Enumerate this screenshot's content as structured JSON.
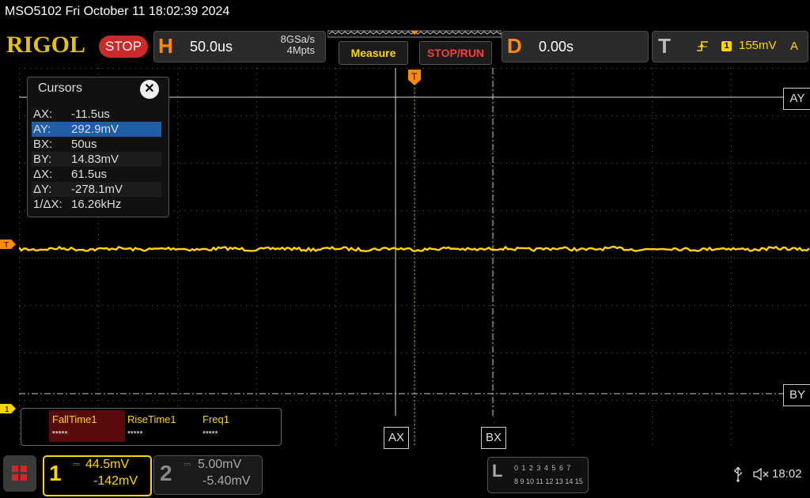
{
  "header": {
    "model_time": "MSO5102  Fri October 11 18:02:39 2024",
    "logo": "RIGOL",
    "run_state": "STOP"
  },
  "horizontal": {
    "letter": "H",
    "timebase": "50.0us",
    "sample_rate": "8GSa/s",
    "memory_depth": "4Mpts"
  },
  "buttons": {
    "measure": "Measure",
    "stop_run": "STOP/RUN"
  },
  "delay": {
    "letter": "D",
    "value": "0.00s"
  },
  "trigger": {
    "letter": "T",
    "channel": "1",
    "level": "155mV",
    "mode": "A",
    "level_marker": "T",
    "position_marker": "T"
  },
  "cursors": {
    "title": "Cursors",
    "close_glyph": "✕",
    "selected_index": 1,
    "rows": [
      {
        "key": "AX:",
        "value": "-11.5us"
      },
      {
        "key": "AY:",
        "value": "292.9mV"
      },
      {
        "key": "BX:",
        "value": "50us"
      },
      {
        "key": "BY:",
        "value": "14.83mV"
      },
      {
        "key": "ΔX:",
        "value": "61.5us"
      },
      {
        "key": "ΔY:",
        "value": "-278.1mV"
      },
      {
        "key": "1/ΔX:",
        "value": "16.26kHz"
      }
    ],
    "tags": {
      "ay": "AY",
      "by": "BY",
      "ax": "AX",
      "bx": "BX"
    }
  },
  "measurements": [
    {
      "label": "FallTime1",
      "value": "*****"
    },
    {
      "label": "RiseTime1",
      "value": "*****"
    },
    {
      "label": "Freq1",
      "value": "*****"
    }
  ],
  "channel1": {
    "number": "1",
    "coupling_glyph": "⎓",
    "scale": "44.5mV",
    "offset": "-142mV",
    "marker": "1",
    "color": "#ffd400"
  },
  "channel2": {
    "number": "2",
    "coupling_glyph": "⎓",
    "scale": "5.00mV",
    "offset": "-5.40mV"
  },
  "logic": {
    "letter": "L",
    "row1": "0 1 2 3   4 5 6 7",
    "row2": "8 9 10 11  12 13 14 15"
  },
  "status": {
    "clock": "18:02"
  },
  "colors": {
    "accent_orange": "#ff8c00",
    "trace_yellow": "#ffd400",
    "stop_red": "#cc2a2a",
    "selected_blue": "#1f5fa8"
  }
}
